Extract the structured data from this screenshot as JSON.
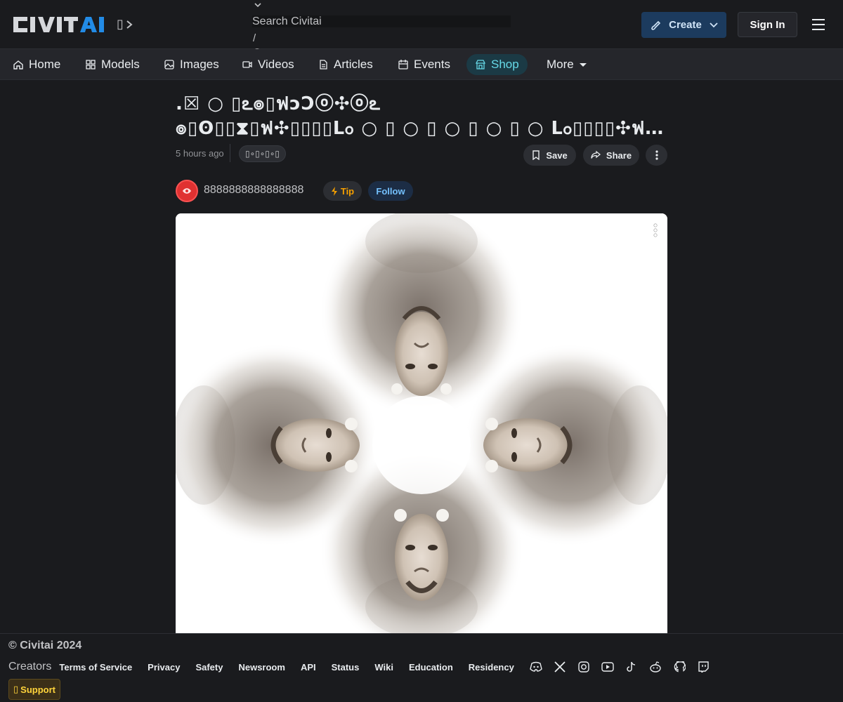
{
  "header": {
    "logo_text": "CIVITAI",
    "logo_extra": "▯",
    "search_placeholder": "Search Civitai",
    "search_shortcut": "/",
    "create_label": "Create",
    "signin_label": "Sign In"
  },
  "nav": {
    "items": [
      {
        "label": "Home",
        "icon": "home-icon"
      },
      {
        "label": "Models",
        "icon": "grid-icon"
      },
      {
        "label": "Images",
        "icon": "image-icon"
      },
      {
        "label": "Videos",
        "icon": "video-icon"
      },
      {
        "label": "Articles",
        "icon": "article-icon"
      },
      {
        "label": "Events",
        "icon": "calendar-icon"
      },
      {
        "label": "Shop",
        "icon": "shop-icon"
      },
      {
        "label": "More",
        "icon": "caret-down-icon"
      }
    ]
  },
  "post": {
    "title_line1": ".☒ ○ ▯ఽ๏▯ฟɔƆⓞ✣ⓞఽ",
    "title_line2": "๏▯ʘ▯▯⧗▯ฟ✣▯▯▯▯ᒪჿ ○ ▯ ○ ▯ ○ ▯ ○ ▯ ○ ᒪჿ▯▯▯▯✣ฟ...",
    "time": "5 hours ago",
    "tag": "▯∘▯∘▯∘▯",
    "save_label": "Save",
    "share_label": "Share",
    "username": "8888888888888888",
    "tip_label": "Tip",
    "follow_label": "Follow"
  },
  "footer": {
    "copyright": "© Civitai 2024",
    "creators": "Creators",
    "links": [
      "Terms of Service",
      "Privacy",
      "Safety",
      "Newsroom",
      "API",
      "Status",
      "Wiki",
      "Education",
      "Residency"
    ],
    "social": [
      "discord-icon",
      "x-icon",
      "instagram-icon",
      "youtube-icon",
      "tiktok-icon",
      "reddit-icon",
      "github-icon",
      "twitch-icon"
    ],
    "support_label": "Support",
    "support_glyph": "▯"
  },
  "colors": {
    "background": "#1a1b1e",
    "nav_background": "#25262b",
    "accent_blue": "#228be6",
    "shop_accent": "#66d9e8",
    "tip_accent": "#f59f00"
  }
}
